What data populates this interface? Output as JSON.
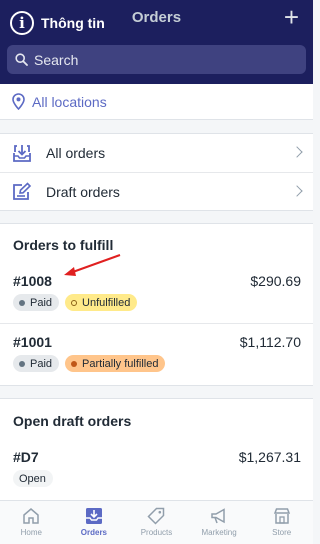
{
  "header": {
    "info_label": "Thông tin",
    "title": "Orders",
    "add_icon": "plus-icon"
  },
  "search": {
    "placeholder": "Search"
  },
  "locations": {
    "label": "All locations"
  },
  "menu": {
    "items": [
      {
        "label": "All orders",
        "icon": "inbox-download-icon"
      },
      {
        "label": "Draft orders",
        "icon": "edit-document-icon"
      }
    ]
  },
  "fulfill": {
    "title": "Orders to fulfill",
    "orders": [
      {
        "id": "#1008",
        "amount": "$290.69",
        "payment": "Paid",
        "status": "Unfulfilled"
      },
      {
        "id": "#1001",
        "amount": "$1,112.70",
        "payment": "Paid",
        "status": "Partially fulfilled"
      }
    ]
  },
  "drafts": {
    "title": "Open draft orders",
    "orders": [
      {
        "id": "#D7",
        "amount": "$1,267.31",
        "status": "Open"
      }
    ]
  },
  "tabs": [
    {
      "label": "Home",
      "icon": "home-icon"
    },
    {
      "label": "Orders",
      "icon": "orders-icon",
      "active": true
    },
    {
      "label": "Products",
      "icon": "tag-icon"
    },
    {
      "label": "Marketing",
      "icon": "megaphone-icon"
    },
    {
      "label": "Store",
      "icon": "store-icon"
    }
  ],
  "colors": {
    "header_bg": "#1c1f5e",
    "accent": "#5c6ac4",
    "annotation_arrow": "#e02020"
  }
}
